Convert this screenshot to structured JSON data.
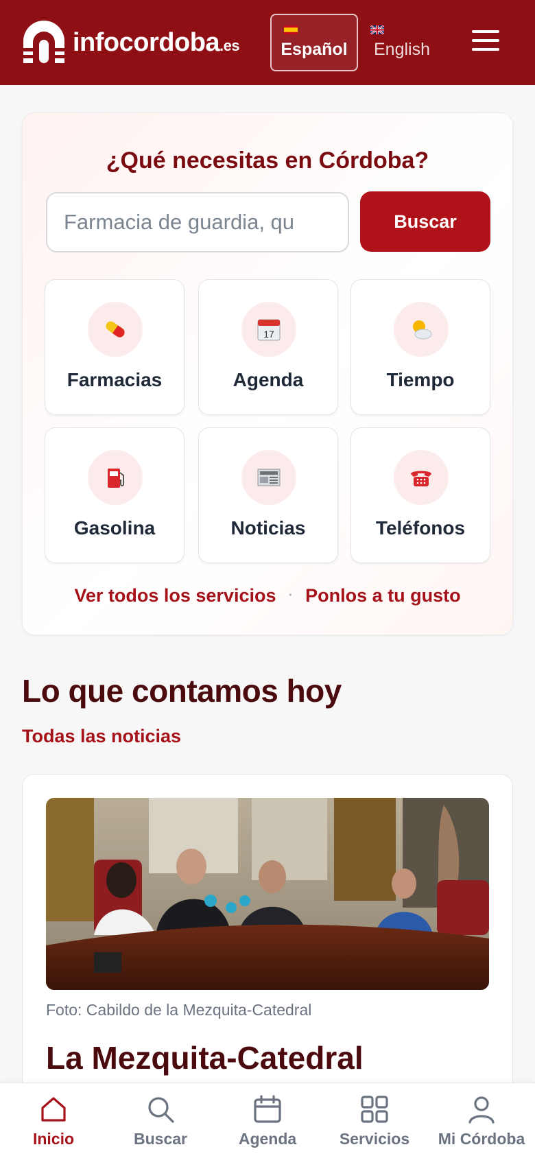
{
  "header": {
    "logo": {
      "name": "infocordoba",
      "tld": ".es"
    },
    "languages": [
      {
        "label": "Español",
        "flag": "spain-flag-icon",
        "active": true
      },
      {
        "label": "English",
        "flag": "uk-flag-icon",
        "active": false
      }
    ],
    "menu_icon": "hamburger-menu-icon"
  },
  "search": {
    "title": "¿Qué necesitas en Córdoba?",
    "placeholder": "Farmacia de guardia, qu",
    "button_label": "Buscar"
  },
  "services": [
    {
      "label": "Farmacias",
      "icon": "pill-icon"
    },
    {
      "label": "Agenda",
      "icon": "calendar-icon"
    },
    {
      "label": "Tiempo",
      "icon": "sun-cloud-icon"
    },
    {
      "label": "Gasolina",
      "icon": "fuel-pump-icon"
    },
    {
      "label": "Noticias",
      "icon": "newspaper-icon"
    },
    {
      "label": "Teléfonos",
      "icon": "telephone-icon"
    }
  ],
  "service_links": {
    "all_services": "Ver todos los servicios",
    "separator": "·",
    "customize": "Ponlos a tu gusto"
  },
  "news": {
    "heading": "Lo que contamos hoy",
    "all_news": "Todas las noticias",
    "featured": {
      "photo_caption": "Foto: Cabildo de la Mezquita-Catedral",
      "title": "La Mezquita-Catedral"
    }
  },
  "bottom_nav": [
    {
      "label": "Inicio",
      "icon": "home-icon",
      "active": true
    },
    {
      "label": "Buscar",
      "icon": "search-icon",
      "active": false
    },
    {
      "label": "Agenda",
      "icon": "calendar-icon",
      "active": false
    },
    {
      "label": "Servicios",
      "icon": "grid-icon",
      "active": false
    },
    {
      "label": "Mi Córdoba",
      "icon": "user-icon",
      "active": false
    }
  ],
  "colors": {
    "brand": "#8e0f14",
    "accent": "#a6121a",
    "heading": "#4b0a0d"
  }
}
